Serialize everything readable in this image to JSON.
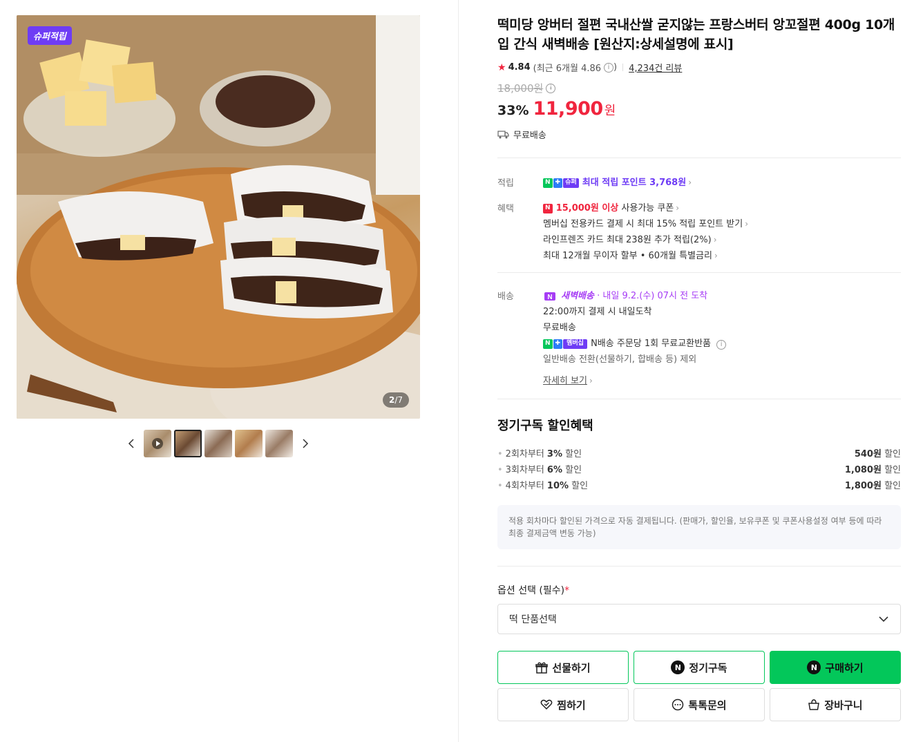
{
  "gallery": {
    "badge": "슈퍼적립",
    "counter_current": "2",
    "counter_total": "/7",
    "thumbnail_count": 5,
    "active_thumbnail": 2
  },
  "product": {
    "title": "떡미당 앙버터 절편 국내산쌀 굳지않는 프랑스버터 앙꼬절편 400g 10개입 간식 새벽배송 [원산지:상세설명에 표시]",
    "rating": "4.84",
    "recent_rating": "(최근 6개월 4.86",
    "recent_rating_close": ")",
    "review_count": "4,234건 리뷰",
    "original_price": "18,000원",
    "discount_rate": "33%",
    "sale_price": "11,900",
    "currency": "원",
    "shipping": "무료배송"
  },
  "points": {
    "label": "적립",
    "badge_n": "N",
    "badge_plus": "✚",
    "badge_super": "슈퍼",
    "text": "최대 적립 포인트 3,768원"
  },
  "benefits": {
    "label": "혜택",
    "badge_n": "N",
    "coupon_amount": "15,000원 이상",
    "coupon_text": " 사용가능 쿠폰",
    "items": [
      "멤버십 전용카드 결제 시 최대 15% 적립 포인트 받기",
      "라인프렌즈 카드 최대 238원 추가 적립(2%)",
      "최대 12개월 무이자 할부 • 60개월 특별금리"
    ]
  },
  "delivery": {
    "label": "배송",
    "dawn_label": "새벽배송",
    "dawn_date": "· 내일 9.2.(수) 07시 전 도착",
    "line1": "22:00까지 결제 시 내일도착",
    "line2": "무료배송",
    "badge_n": "N",
    "badge_plus": "✚",
    "badge_member": "멤버십",
    "member_text": "N배송 주문당 1회 무료교환반품",
    "line4": "일반배송 전환(선물하기, 합배송 등) 제외",
    "more_link": "자세히 보기"
  },
  "subscription": {
    "title": "정기구독 할인혜택",
    "items": [
      {
        "prefix": "2회차부터 ",
        "rate": "3%",
        "suffix": " 할인",
        "amount": "540원",
        "amount_suffix": " 할인"
      },
      {
        "prefix": "3회차부터 ",
        "rate": "6%",
        "suffix": " 할인",
        "amount": "1,080원",
        "amount_suffix": " 할인"
      },
      {
        "prefix": "4회차부터 ",
        "rate": "10%",
        "suffix": " 할인",
        "amount": "1,800원",
        "amount_suffix": " 할인"
      }
    ],
    "notice": "적용 회차마다 할인된 가격으로 자동 결제됩니다. (판매가, 할인율, 보유쿠폰 및 쿠폰사용설정 여부 등에 따라 최종 결제금액 변동 가능)"
  },
  "options": {
    "label": "옵션 선택 (필수)",
    "required_mark": "*",
    "select_value": "떡 단품선택"
  },
  "buttons": {
    "gift": "선물하기",
    "subscribe": "정기구독",
    "buy": "구매하기",
    "wish": "찜하기",
    "talk": "톡톡문의",
    "cart": "장바구니",
    "n_mark": "N"
  },
  "colors": {
    "accent_green": "#03c75a",
    "price_red": "#f0253e",
    "super_purple": "#6e3cf5"
  }
}
